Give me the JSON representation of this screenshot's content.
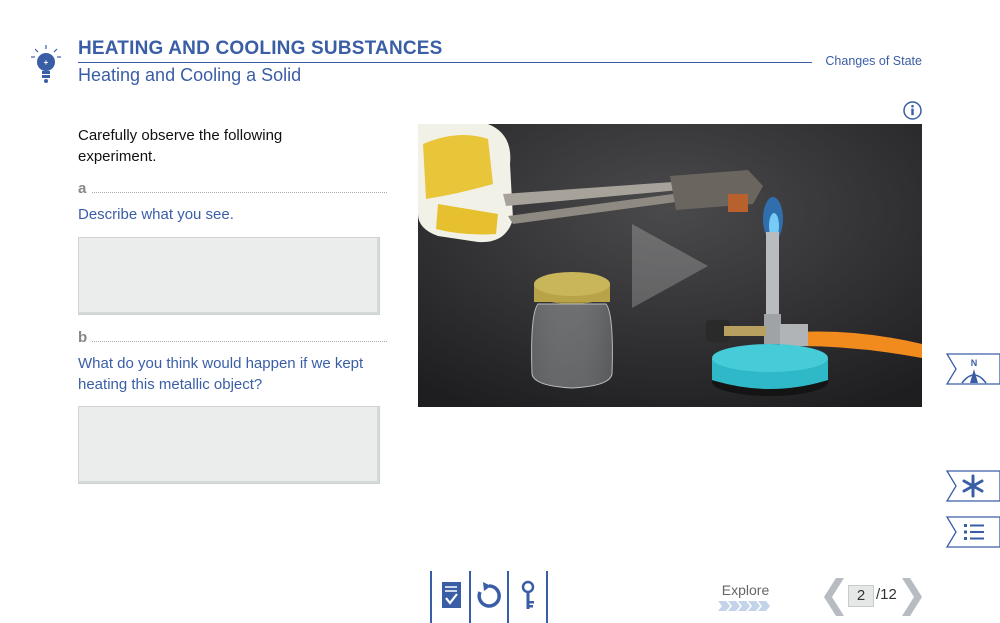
{
  "header": {
    "title": "HEATING AND COOLING SUBSTANCES",
    "subtitle": "Heating and Cooling a Solid",
    "chapter": "Changes of State"
  },
  "content": {
    "intro": "Carefully observe the following experiment.",
    "questions": [
      {
        "letter": "a",
        "text": "Describe what you see.",
        "answer": ""
      },
      {
        "letter": "b",
        "text": "What do you think would happen if we kept heating this metallic object?",
        "answer": ""
      }
    ]
  },
  "side_tabs": {
    "compass_label": "N"
  },
  "footer": {
    "explore_label": "Explore",
    "page_current": "2",
    "page_total": "/12"
  },
  "colors": {
    "accent": "#3a5ea6",
    "answer_bg": "#ebeded",
    "pager_gray": "#b7bcc2"
  },
  "icons": [
    "lightbulb-logo-icon",
    "info-icon",
    "play-icon",
    "compass-icon",
    "asterisk-icon",
    "list-icon",
    "checklist-icon",
    "reset-icon",
    "key-icon",
    "chevron-left-icon",
    "chevron-right-icon"
  ]
}
